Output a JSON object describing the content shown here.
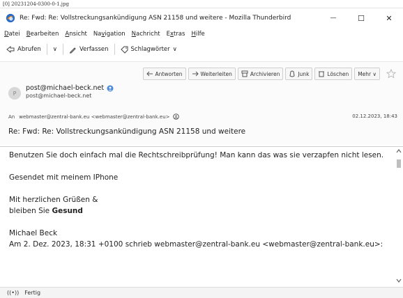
{
  "filename": "[0] 20231204-0300-0-1.jpg",
  "window": {
    "title": "Re: Fwd: Re: Vollstreckungsankündigung ASN 21158 und weitere - Mozilla Thunderbird",
    "minimize": "—",
    "maximize": "☐",
    "close": "✕"
  },
  "menu": [
    {
      "pre": "",
      "key": "D",
      "post": "atei"
    },
    {
      "pre": "",
      "key": "B",
      "post": "earbeiten"
    },
    {
      "pre": "",
      "key": "A",
      "post": "nsicht"
    },
    {
      "pre": "Na",
      "key": "v",
      "post": "igation"
    },
    {
      "pre": "",
      "key": "N",
      "post": "achricht"
    },
    {
      "pre": "E",
      "key": "x",
      "post": "tras"
    },
    {
      "pre": "",
      "key": "H",
      "post": "ilfe"
    }
  ],
  "toolbar": {
    "get_messages": "Abrufen",
    "get_messages_dropdown": "∨",
    "write": "Verfassen",
    "tags": "Schlagwörter",
    "tags_dropdown": "∨"
  },
  "actions": {
    "reply": "Antworten",
    "forward": "Weiterleiten",
    "archive": "Archivieren",
    "junk": "Junk",
    "delete": "Löschen",
    "more": "Mehr ∨"
  },
  "header": {
    "avatar_letter": "P",
    "from_name": "post@michael-beck.net",
    "from_addr": "post@michael-beck.net",
    "to_label": "An",
    "to_value": "webmaster@zentral-bank.eu <webmaster@zentral-bank.eu>",
    "date": "02.12.2023, 18:43",
    "subject": "Re: Fwd: Re: Vollstreckungsankündigung ASN 21158 und weitere"
  },
  "body": {
    "line1": "Benutzen Sie doch einfach mal die Rechtschreibprüfung! Man kann das was sie verzapfen nicht lesen.",
    "line2": "Gesendet mit meinem IPhone",
    "line3": "Mit herzlichen Grüßen &",
    "line4_pre": "bleiben Sie ",
    "line4_bold": "Gesund",
    "line5": "Michael Beck",
    "line6": "Am 2. Dez. 2023, 18:31 +0100 schrieb webmaster@zentral-bank.eu <webmaster@zentral-bank.eu>:"
  },
  "status": {
    "icon_text": "((•))",
    "text": "Fertig"
  },
  "colors": {
    "accent_blue": "#2a6cc4",
    "logo_orange": "#1a5fb4"
  }
}
